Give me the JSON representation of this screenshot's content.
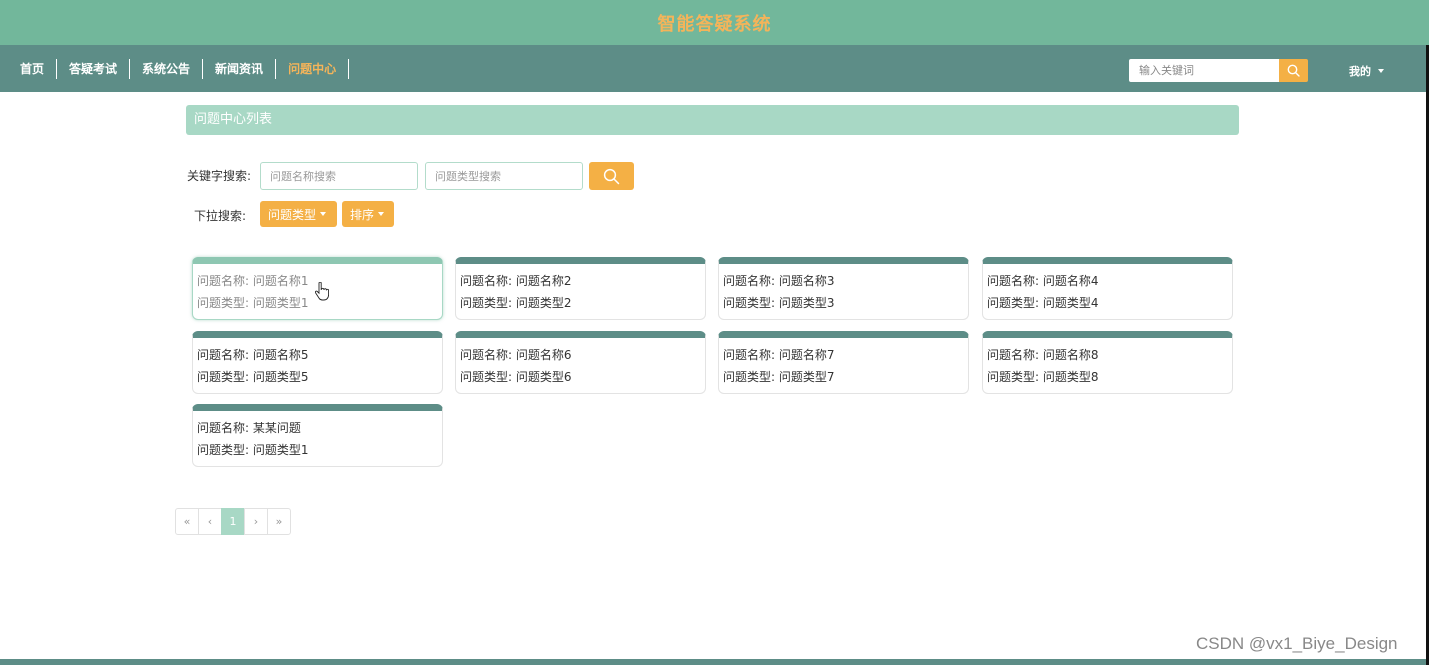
{
  "app": {
    "title": "智能答疑系统"
  },
  "nav": {
    "items": [
      {
        "label": "首页"
      },
      {
        "label": "答疑考试"
      },
      {
        "label": "系统公告"
      },
      {
        "label": "新闻资讯"
      },
      {
        "label": "问题中心",
        "active": true
      }
    ],
    "search_placeholder": "输入关键词",
    "user_label": "我的"
  },
  "page": {
    "header": "问题中心列表"
  },
  "filters": {
    "keyword_label": "关键字搜索:",
    "name_placeholder": "问题名称搜索",
    "type_placeholder": "问题类型搜索",
    "dropdown_label": "下拉搜索:",
    "type_dropdown": "问题类型",
    "sort_dropdown": "排序"
  },
  "cards": [
    {
      "name_label": "问题名称:",
      "name": "问题名称1",
      "type_label": "问题类型:",
      "type": "问题类型1"
    },
    {
      "name_label": "问题名称:",
      "name": "问题名称2",
      "type_label": "问题类型:",
      "type": "问题类型2"
    },
    {
      "name_label": "问题名称:",
      "name": "问题名称3",
      "type_label": "问题类型:",
      "type": "问题类型3"
    },
    {
      "name_label": "问题名称:",
      "name": "问题名称4",
      "type_label": "问题类型:",
      "type": "问题类型4"
    },
    {
      "name_label": "问题名称:",
      "name": "问题名称5",
      "type_label": "问题类型:",
      "type": "问题类型5"
    },
    {
      "name_label": "问题名称:",
      "name": "问题名称6",
      "type_label": "问题类型:",
      "type": "问题类型6"
    },
    {
      "name_label": "问题名称:",
      "name": "问题名称7",
      "type_label": "问题类型:",
      "type": "问题类型7"
    },
    {
      "name_label": "问题名称:",
      "name": "问题名称8",
      "type_label": "问题类型:",
      "type": "问题类型8"
    },
    {
      "name_label": "问题名称:",
      "name": "某某问题",
      "type_label": "问题类型:",
      "type": "问题类型1"
    }
  ],
  "pagination": {
    "first": "«",
    "prev": "‹",
    "current": "1",
    "next": "›",
    "last": "»"
  },
  "watermark": "CSDN @vx1_Biye_Design",
  "colors": {
    "title_bar": "#72b79b",
    "nav_bar": "#5d8d87",
    "accent_orange": "#f4b045",
    "header_mint": "#a8d8c5"
  }
}
